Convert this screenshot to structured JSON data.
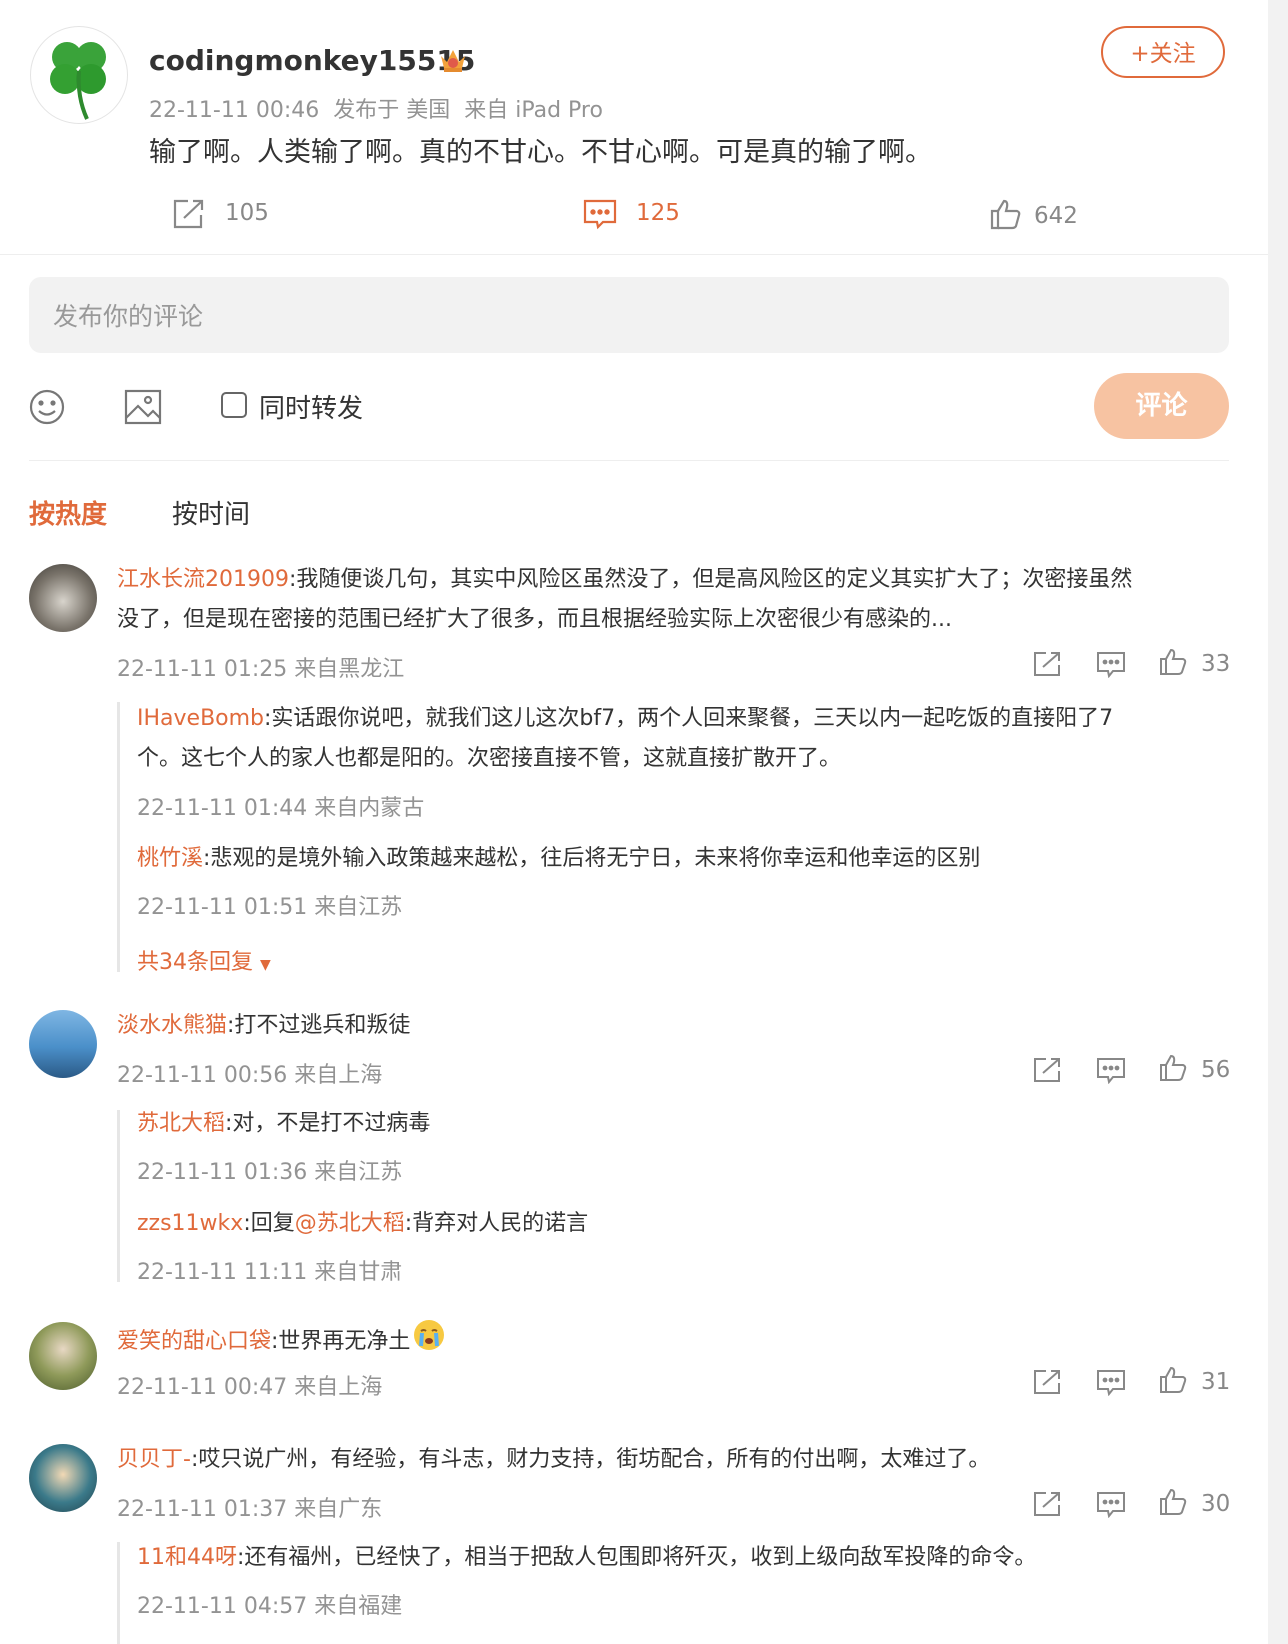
{
  "post": {
    "username": "codingmonkey15515",
    "meta": "22-11-11 00:46  发布于 美国  来自 iPad Pro",
    "text": "输了啊。人类输了啊。真的不甘心。不甘心啊。可是真的输了啊。",
    "follow_label": "+关注",
    "repost_count": "105",
    "comment_count": "125",
    "like_count": "642"
  },
  "composer": {
    "placeholder": "发布你的评论",
    "forward_label": "同时转发",
    "submit_label": "评论"
  },
  "sort_tabs": [
    {
      "label": "按热度",
      "active": true
    },
    {
      "label": "按时间",
      "active": false
    }
  ],
  "comments": [
    {
      "user": "江水长流201909",
      "text_line1": ":我随便谈几句，其实中风险区虽然没了，但是高风险区的定义其实扩大了；次密接虽然",
      "text_line2": "没了，但是现在密接的范围已经扩大了很多，而且根据经验实际上次密很少有感染的...",
      "meta": "22-11-11 01:25 来自黑龙江",
      "likes": "33",
      "replies": [
        {
          "user": "IHaveBomb",
          "text_line1": ":实话跟你说吧，就我们这儿这次bf7，两个人回来聚餐，三天以内一起吃饭的直接阳了7",
          "text_line2": "个。这七个人的家人也都是阳的。次密接直接不管，这就直接扩散开了。",
          "meta": "22-11-11 01:44 来自内蒙古"
        },
        {
          "user": "桃竹溪",
          "text": ":悲观的是境外输入政策越来越松，往后将无宁日，未来将你幸运和他幸运的区别",
          "meta": "22-11-11 01:51 来自江苏"
        }
      ],
      "more_replies": "共34条回复"
    },
    {
      "user": "淡水水熊猫",
      "text": ":打不过逃兵和叛徒",
      "meta": "22-11-11 00:56 来自上海",
      "likes": "56",
      "replies": [
        {
          "user": "苏北大稻",
          "text": ":对，不是打不过病毒",
          "meta": "22-11-11 01:36 来自江苏"
        },
        {
          "user": "zzs11wkx",
          "text_prefix": ":回复",
          "mention": "@苏北大稻",
          "text": ":背弃对人民的诺言",
          "meta": "22-11-11 11:11 来自甘肃"
        }
      ]
    },
    {
      "user": "爱笑的甜心口袋",
      "text": ":世界再无净土",
      "emoji": "crying-face-icon",
      "meta": "22-11-11 00:47 来自上海",
      "likes": "31"
    },
    {
      "user": "贝贝丁-",
      "text": ":哎只说广州，有经验，有斗志，财力支持，街坊配合，所有的付出啊，太难过了。",
      "meta": "22-11-11 01:37 来自广东",
      "likes": "30",
      "replies": [
        {
          "user": "11和44呀",
          "text": ":还有福州，已经快了，相当于把敌人包围即将歼灭，收到上级向敌军投降的命令。",
          "meta": "22-11-11 04:57 来自福建"
        }
      ]
    }
  ],
  "colors": {
    "accent": "#e06a3b",
    "submit_disabled": "#f7c3a2",
    "input_bg": "#f2f2f2"
  }
}
